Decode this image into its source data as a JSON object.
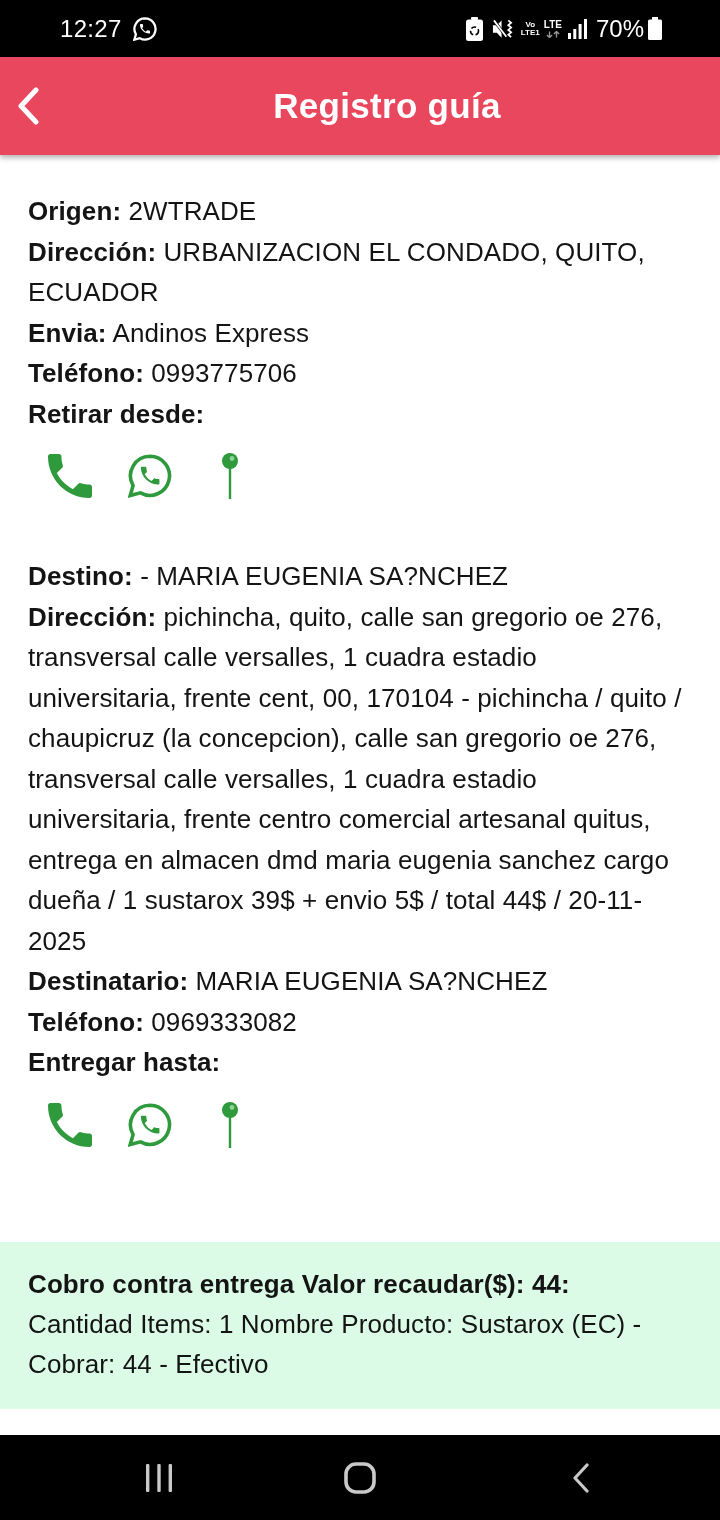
{
  "status_bar": {
    "time": "12:27",
    "volte": "Vo LTE1",
    "network": "LTE",
    "battery": "70%"
  },
  "app_bar": {
    "title": "Registro guía"
  },
  "sections": [
    {
      "fields": [
        {
          "label": "Origen:",
          "value": "2WTRADE"
        },
        {
          "label": "Dirección:",
          "value": "URBANIZACION EL CONDADO, QUITO, ECUADOR"
        },
        {
          "label": "Envia:",
          "value": "Andinos Express"
        },
        {
          "label": "Teléfono:",
          "value": "0993775706"
        },
        {
          "label": "Retirar desde:"
        }
      ],
      "actions": [
        {
          "kind": "call"
        },
        {
          "kind": "whatsapp"
        },
        {
          "kind": "map"
        }
      ]
    },
    {
      "fields": [
        {
          "label": "Destino:",
          "value": "- MARIA EUGENIA SA?NCHEZ"
        },
        {
          "label": "Dirección:",
          "value": "pichincha, quito, calle san gregorio oe 276, transversal calle versalles, 1 cuadra estadio universitaria, frente cent, 00, 170104 - pichincha / quito / chaupicruz (la concepcion), calle san gregorio oe 276, transversal calle versalles, 1 cuadra estadio universitaria, frente centro comercial artesanal quitus, entrega en almacen dmd maria eugenia sanchez cargo dueña / 1 sustarox 39$ + envio 5$ / total 44$ / 20-11-2025"
        },
        {
          "label": "Destinatario:",
          "value": "MARIA EUGENIA SA?NCHEZ"
        },
        {
          "label": "Teléfono:",
          "value": "0969333082"
        },
        {
          "label": "Entregar hasta:"
        }
      ],
      "actions": [
        {
          "kind": "call"
        },
        {
          "kind": "whatsapp"
        },
        {
          "kind": "map"
        }
      ]
    }
  ],
  "payment": {
    "title": "Cobro contra entrega Valor recaudar($): 44:",
    "detail": "Cantidad Items: 1 Nombre Producto: Sustarox (EC) - Cobrar: 44 - Efectivo"
  },
  "nav_bar": {
    "buttons": [
      {
        "kind": "recents"
      },
      {
        "kind": "home"
      },
      {
        "kind": "back"
      }
    ]
  }
}
